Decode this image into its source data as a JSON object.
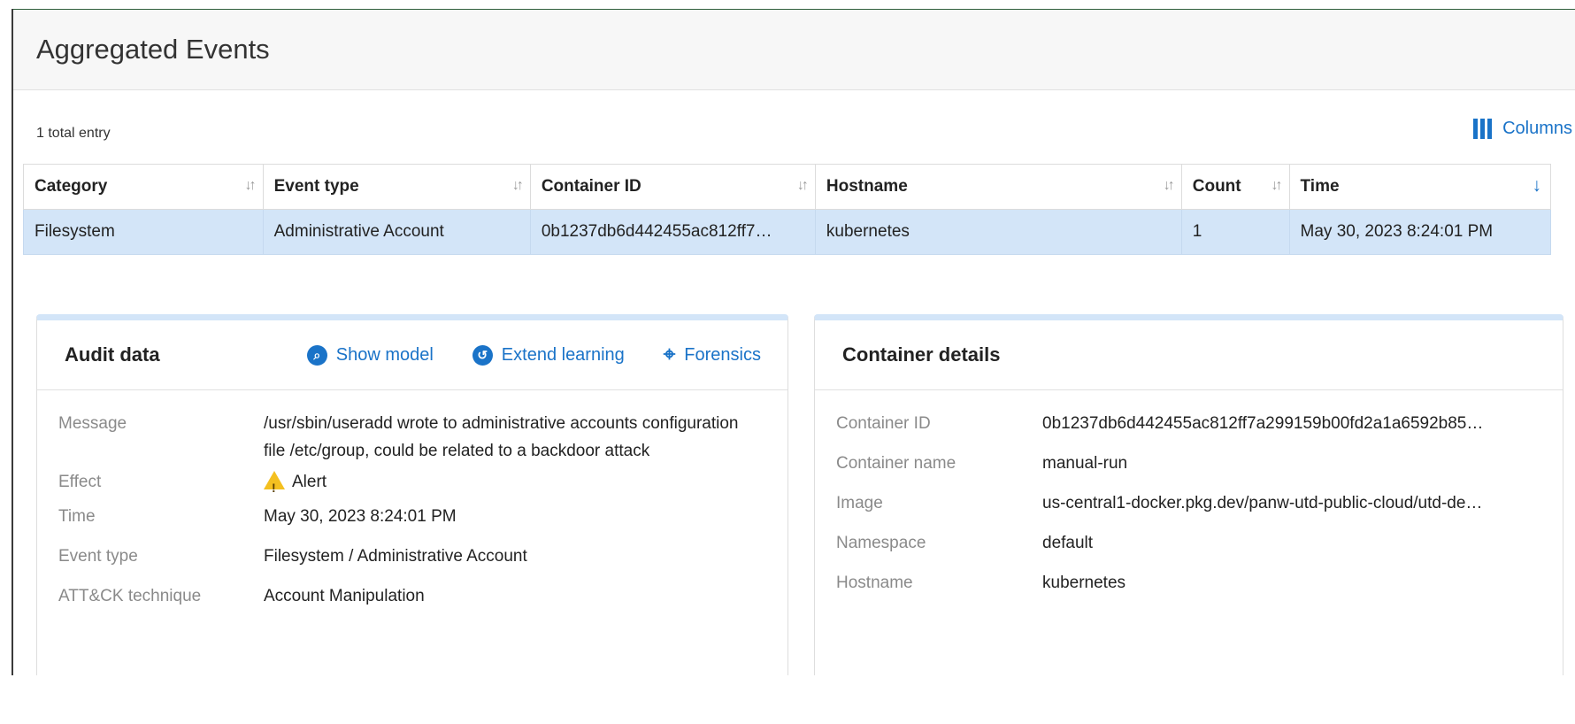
{
  "page": {
    "title": "Aggregated Events"
  },
  "toolbar": {
    "total": "1 total entry",
    "columns_label": "Columns"
  },
  "table": {
    "headers": [
      "Category",
      "Event type",
      "Container ID",
      "Hostname",
      "Count",
      "Time"
    ],
    "rows": [
      [
        "Filesystem",
        "Administrative Account",
        "0b1237db6d442455ac812ff7…",
        "kubernetes",
        "1",
        "May 30, 2023 8:24:01 PM"
      ]
    ]
  },
  "audit": {
    "title": "Audit data",
    "actions": {
      "show_model": "Show model",
      "extend_learning": "Extend learning",
      "forensics": "Forensics"
    },
    "fields": [
      {
        "k": "Message",
        "v": "/usr/sbin/useradd wrote to administrative accounts configuration file /etc/group, could be related to a backdoor attack"
      },
      {
        "k": "Effect",
        "v": "Alert"
      },
      {
        "k": "Time",
        "v": "May 30, 2023 8:24:01 PM"
      },
      {
        "k": "Event type",
        "v": "Filesystem / Administrative Account"
      },
      {
        "k": "ATT&CK technique",
        "v": "Account Manipulation"
      }
    ]
  },
  "container": {
    "title": "Container details",
    "fields": [
      {
        "k": "Container ID",
        "v": "0b1237db6d442455ac812ff7a299159b00fd2a1a6592b85…"
      },
      {
        "k": "Container name",
        "v": "manual-run"
      },
      {
        "k": "Image",
        "v": "us-central1-docker.pkg.dev/panw-utd-public-cloud/utd-de…"
      },
      {
        "k": "Namespace",
        "v": "default"
      },
      {
        "k": "Hostname",
        "v": "kubernetes"
      }
    ]
  },
  "colors": {
    "accent": "#1a73c8",
    "selected_row": "#d3e5f8",
    "warning": "#f4c020"
  }
}
